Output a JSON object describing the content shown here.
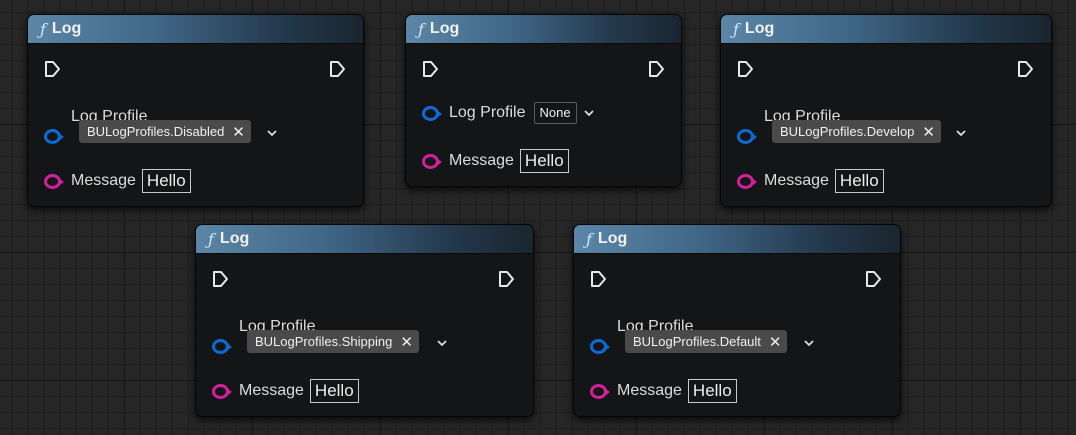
{
  "nodes": [
    {
      "title": "Log",
      "exec_in_icon": "exec-triangle-icon",
      "exec_out_icon": "exec-triangle-icon",
      "log_profile_label": "Log Profile",
      "log_profile_value": "BULogProfiles.Disabled",
      "clear_symbol": "✕",
      "message_label": "Message",
      "message_value": "Hello"
    },
    {
      "title": "Log",
      "exec_in_icon": "exec-triangle-icon",
      "exec_out_icon": "exec-triangle-icon",
      "log_profile_label": "Log Profile",
      "log_profile_value": "None",
      "message_label": "Message",
      "message_value": "Hello"
    },
    {
      "title": "Log",
      "exec_in_icon": "exec-triangle-icon",
      "exec_out_icon": "exec-triangle-icon",
      "log_profile_label": "Log Profile",
      "log_profile_value": "BULogProfiles.Develop",
      "clear_symbol": "✕",
      "message_label": "Message",
      "message_value": "Hello"
    },
    {
      "title": "Log",
      "exec_in_icon": "exec-triangle-icon",
      "exec_out_icon": "exec-triangle-icon",
      "log_profile_label": "Log Profile",
      "log_profile_value": "BULogProfiles.Shipping",
      "clear_symbol": "✕",
      "message_label": "Message",
      "message_value": "Hello"
    },
    {
      "title": "Log",
      "exec_in_icon": "exec-triangle-icon",
      "exec_out_icon": "exec-triangle-icon",
      "log_profile_label": "Log Profile",
      "log_profile_value": "BULogProfiles.Default",
      "clear_symbol": "✕",
      "message_label": "Message",
      "message_value": "Hello"
    }
  ],
  "function_icon_glyph": "ƒ",
  "colors": {
    "grid_background": "#262626",
    "node_body": "#141516",
    "header_blue": "#4f7899",
    "log_profile_pin": "#0c6bd6",
    "message_pin": "#d21f9c",
    "enum_field": "#4a4a4a"
  }
}
